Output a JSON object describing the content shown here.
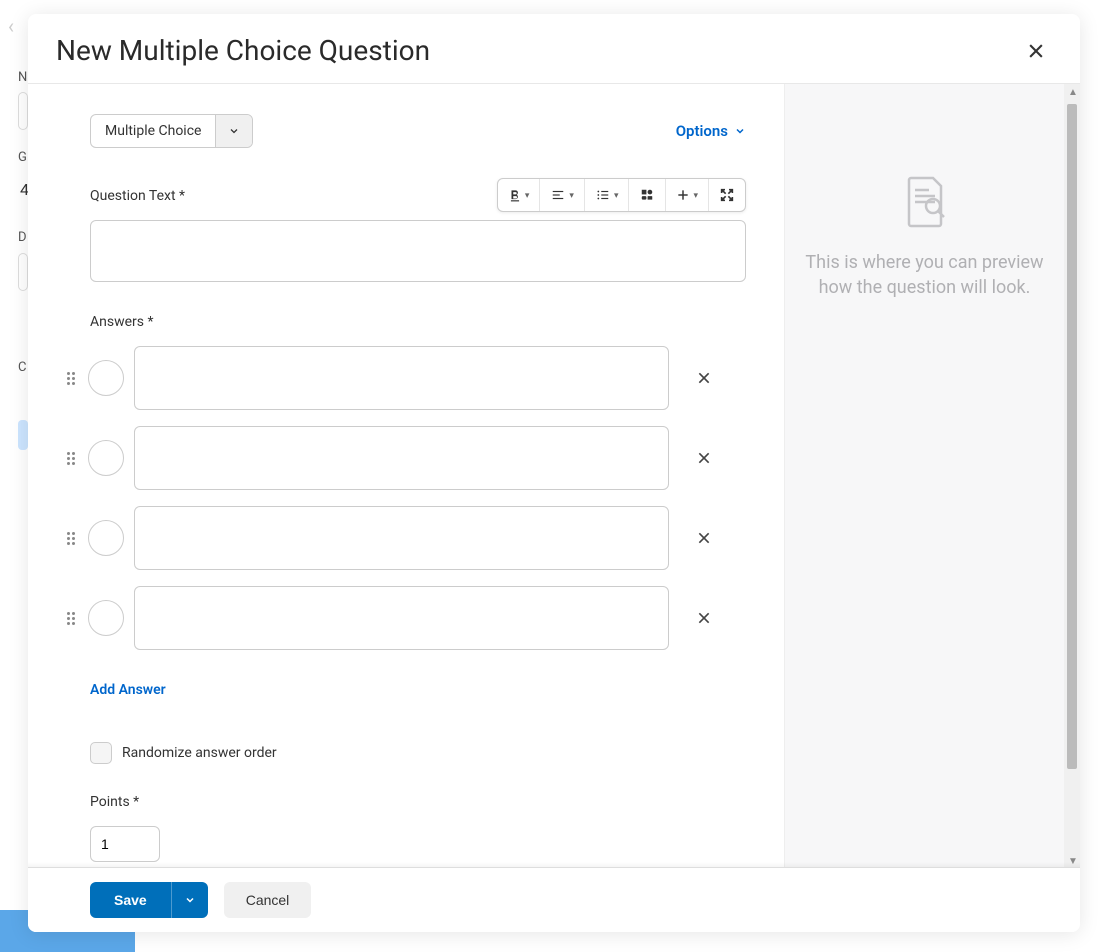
{
  "modal": {
    "title": "New Multiple Choice Question",
    "question_type": "Multiple Choice",
    "options_label": "Options",
    "question_text_label": "Question Text *",
    "question_text_value": "",
    "answers_label": "Answers *",
    "answers": [
      {
        "value": ""
      },
      {
        "value": ""
      },
      {
        "value": ""
      },
      {
        "value": ""
      }
    ],
    "add_answer_label": "Add Answer",
    "randomize_label": "Randomize answer order",
    "points_label": "Points *",
    "points_value": "1",
    "save_label": "Save",
    "cancel_label": "Cancel"
  },
  "preview": {
    "text": "This is where you can preview how the question will look."
  },
  "background": {
    "n": "N",
    "g": "G",
    "d": "D",
    "c": "C",
    "val4": "4"
  }
}
